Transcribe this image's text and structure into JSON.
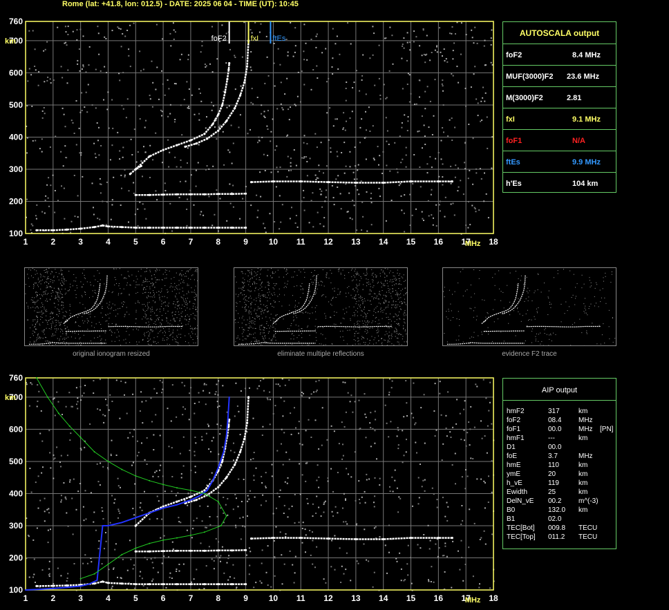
{
  "header": "Rome (lat: +41.8, lon: 012.5) - DATE: 2025 06 04 - TIME (UT): 10:45",
  "colors": {
    "frame": "#ffff66",
    "grid": "#777777",
    "box_border": "#66cc66",
    "yellow": "#ffff66",
    "red": "#ff2222",
    "blue": "#3399ff",
    "profile": "#22cc22",
    "trace_blue": "#2233ff"
  },
  "chart_data": [
    {
      "type": "scatter",
      "title": "",
      "xlabel": "MHz",
      "ylabel": "km",
      "xlim": [
        1,
        18
      ],
      "ylim": [
        100,
        760
      ],
      "xticks": [
        "1",
        "2",
        "3",
        "4",
        "5",
        "6",
        "7",
        "8",
        "9",
        "10",
        "11",
        "12",
        "13",
        "14",
        "15",
        "16",
        "17",
        "18"
      ],
      "yticks": [
        "100",
        "200",
        "300",
        "400",
        "500",
        "600",
        "700",
        "760"
      ],
      "grid": true,
      "markers": [
        {
          "label": "foF2",
          "x": 8.4,
          "color": "#ffffff"
        },
        {
          "label": "fxI",
          "x": 9.1,
          "color": "#ffff66"
        },
        {
          "label": "ftEs",
          "x": 9.9,
          "color": "#3399ff"
        }
      ],
      "series": [
        {
          "x": [
            5.0,
            5.5,
            6.0,
            6.5,
            7.0,
            7.5,
            7.8,
            8.0,
            8.15,
            8.25,
            8.33,
            8.38,
            8.4
          ],
          "y": [
            300,
            340,
            360,
            375,
            390,
            410,
            440,
            470,
            500,
            540,
            580,
            610,
            630
          ]
        },
        {
          "x": [
            6.8,
            7.2,
            7.6,
            8.0,
            8.3,
            8.6,
            8.8,
            8.95,
            9.05,
            9.1
          ],
          "y": [
            370,
            380,
            395,
            420,
            450,
            490,
            530,
            570,
            620,
            700
          ]
        },
        {
          "x": [
            4.8,
            5.0,
            5.2
          ],
          "y": [
            285,
            300,
            310
          ]
        },
        {
          "x": [
            5.0,
            5.5,
            6.0,
            6.5,
            7.0,
            7.5,
            8.0,
            8.5,
            9.0
          ],
          "y": [
            220,
            220,
            221,
            222,
            222,
            222,
            223,
            223,
            224
          ]
        },
        {
          "x": [
            9.2,
            10,
            11,
            12,
            13,
            14,
            15,
            16,
            16.5
          ],
          "y": [
            260,
            262,
            262,
            260,
            258,
            258,
            262,
            262,
            262
          ]
        },
        {
          "x": [
            1.4,
            2,
            2.5,
            3,
            3.5,
            3.8,
            4,
            4.5,
            5,
            5.5,
            6,
            6.5,
            7,
            7.5,
            8,
            8.5,
            9
          ],
          "y": [
            110,
            110,
            112,
            115,
            120,
            125,
            122,
            120,
            118,
            118,
            118,
            118,
            118,
            118,
            118,
            118,
            118
          ]
        }
      ]
    },
    {
      "type": "line",
      "title": "",
      "xlabel": "MHz",
      "ylabel": "km",
      "xlim": [
        1,
        18
      ],
      "ylim": [
        100,
        760
      ],
      "xticks": [
        "1",
        "2",
        "3",
        "4",
        "5",
        "6",
        "7",
        "8",
        "9",
        "10",
        "11",
        "12",
        "13",
        "14",
        "15",
        "16",
        "17",
        "18"
      ],
      "yticks": [
        "100",
        "200",
        "300",
        "400",
        "500",
        "600",
        "700",
        "760"
      ],
      "grid": true,
      "series": [
        {
          "x": [
            5.0,
            5.5,
            6.0,
            6.5,
            7.0,
            7.5,
            7.8,
            8.0,
            8.15,
            8.25,
            8.33,
            8.38,
            8.4
          ],
          "y": [
            300,
            340,
            360,
            375,
            390,
            410,
            440,
            470,
            500,
            540,
            580,
            610,
            630
          ]
        },
        {
          "x": [
            6.8,
            7.2,
            7.6,
            8.0,
            8.3,
            8.6,
            8.8,
            8.95,
            9.05,
            9.1
          ],
          "y": [
            370,
            380,
            395,
            420,
            450,
            490,
            530,
            570,
            620,
            700
          ]
        },
        {
          "x": [
            5.0,
            5.5,
            6.0,
            6.5,
            7.0,
            7.5,
            8.0,
            8.5,
            9.0
          ],
          "y": [
            220,
            220,
            221,
            222,
            222,
            222,
            223,
            223,
            224
          ]
        },
        {
          "x": [
            9.2,
            10,
            11,
            12,
            13,
            14,
            15,
            16,
            16.5
          ],
          "y": [
            260,
            262,
            262,
            260,
            258,
            258,
            262,
            262,
            262
          ]
        },
        {
          "x": [
            1.4,
            2,
            2.5,
            3,
            3.5,
            3.8,
            4,
            4.5,
            5,
            5.5,
            6,
            6.5,
            7,
            7.5,
            8,
            8.5,
            9
          ],
          "y": [
            112,
            113,
            114,
            116,
            120,
            126,
            122,
            120,
            118,
            118,
            118,
            118,
            118,
            118,
            118,
            118,
            118
          ]
        },
        {
          "x": [
            1.0,
            1.5,
            2.0,
            2.5,
            3.0,
            3.3,
            3.6,
            3.8,
            4.0,
            4.5,
            5.0,
            5.5,
            6.0,
            6.5,
            7.0,
            7.3,
            7.6,
            7.8,
            8.0,
            8.2,
            8.3,
            8.35,
            8.4
          ],
          "y": [
            100,
            102,
            105,
            108,
            112,
            118,
            130,
            300,
            300,
            310,
            325,
            340,
            355,
            365,
            380,
            392,
            410,
            440,
            480,
            530,
            580,
            630,
            700
          ]
        },
        {
          "x": [
            1.4,
            1.8,
            2.2,
            2.6,
            3.0,
            3.5,
            4.0,
            4.5,
            5.0,
            5.5,
            6.0,
            6.5,
            7.0,
            7.5,
            8.0,
            8.3,
            8.1,
            7.5,
            7.0,
            6.5,
            6.0,
            5.5,
            5.0,
            4.5,
            4.0,
            3.5,
            3.0
          ],
          "y": [
            760,
            700,
            650,
            610,
            575,
            530,
            500,
            475,
            455,
            440,
            428,
            418,
            410,
            400,
            375,
            330,
            300,
            280,
            270,
            262,
            255,
            245,
            230,
            210,
            180,
            150,
            135
          ]
        }
      ]
    }
  ],
  "autoscala": {
    "title": "AUTOSCALA output",
    "rows": [
      {
        "label": "foF2",
        "value": "8.4 MHz",
        "color": "#ffffff"
      },
      {
        "label": "MUF(3000)F2",
        "value": "23.6 MHz",
        "color": "#ffffff"
      },
      {
        "label": "M(3000)F2",
        "value": "2.81",
        "color": "#ffffff"
      },
      {
        "label": "fxI",
        "value": "9.1 MHz",
        "color": "#ffff66"
      },
      {
        "label": "foF1",
        "value": "N/A",
        "color": "#ff2222"
      },
      {
        "label": "ftEs",
        "value": "9.9 MHz",
        "color": "#3399ff"
      },
      {
        "label": "h'Es",
        "value": "104    km",
        "color": "#ffffff"
      }
    ]
  },
  "thumbnails": [
    {
      "caption": "original ionogram resized"
    },
    {
      "caption": "eliminate multiple reflections"
    },
    {
      "caption": "evidence F2 trace"
    }
  ],
  "aip": {
    "title": "AIP output",
    "rows": [
      [
        "hmF2",
        "317",
        "km",
        ""
      ],
      [
        "foF2",
        "08.4",
        "MHz",
        ""
      ],
      [
        "foF1",
        "00.0",
        "MHz",
        "[PN]"
      ],
      [
        "hmF1",
        "---",
        "km",
        ""
      ],
      [
        "D1",
        "00.0",
        "",
        ""
      ],
      [
        "foE",
        "3.7",
        "MHz",
        ""
      ],
      [
        "hmE",
        "110",
        "km",
        ""
      ],
      [
        "ymE",
        "20",
        "km",
        ""
      ],
      [
        "h_vE",
        "119",
        "km",
        ""
      ],
      [
        "Ewidth",
        "25",
        "km",
        ""
      ],
      [
        "DelN_vE",
        "00.2",
        "m^(-3)",
        ""
      ],
      [
        "B0",
        "132.0",
        "km",
        ""
      ],
      [
        "B1",
        "02.0",
        "",
        ""
      ],
      [
        "TEC[Bot]",
        "009.8",
        "TECU",
        ""
      ],
      [
        "TEC[Top]",
        "011.2",
        "TECU",
        ""
      ]
    ]
  }
}
